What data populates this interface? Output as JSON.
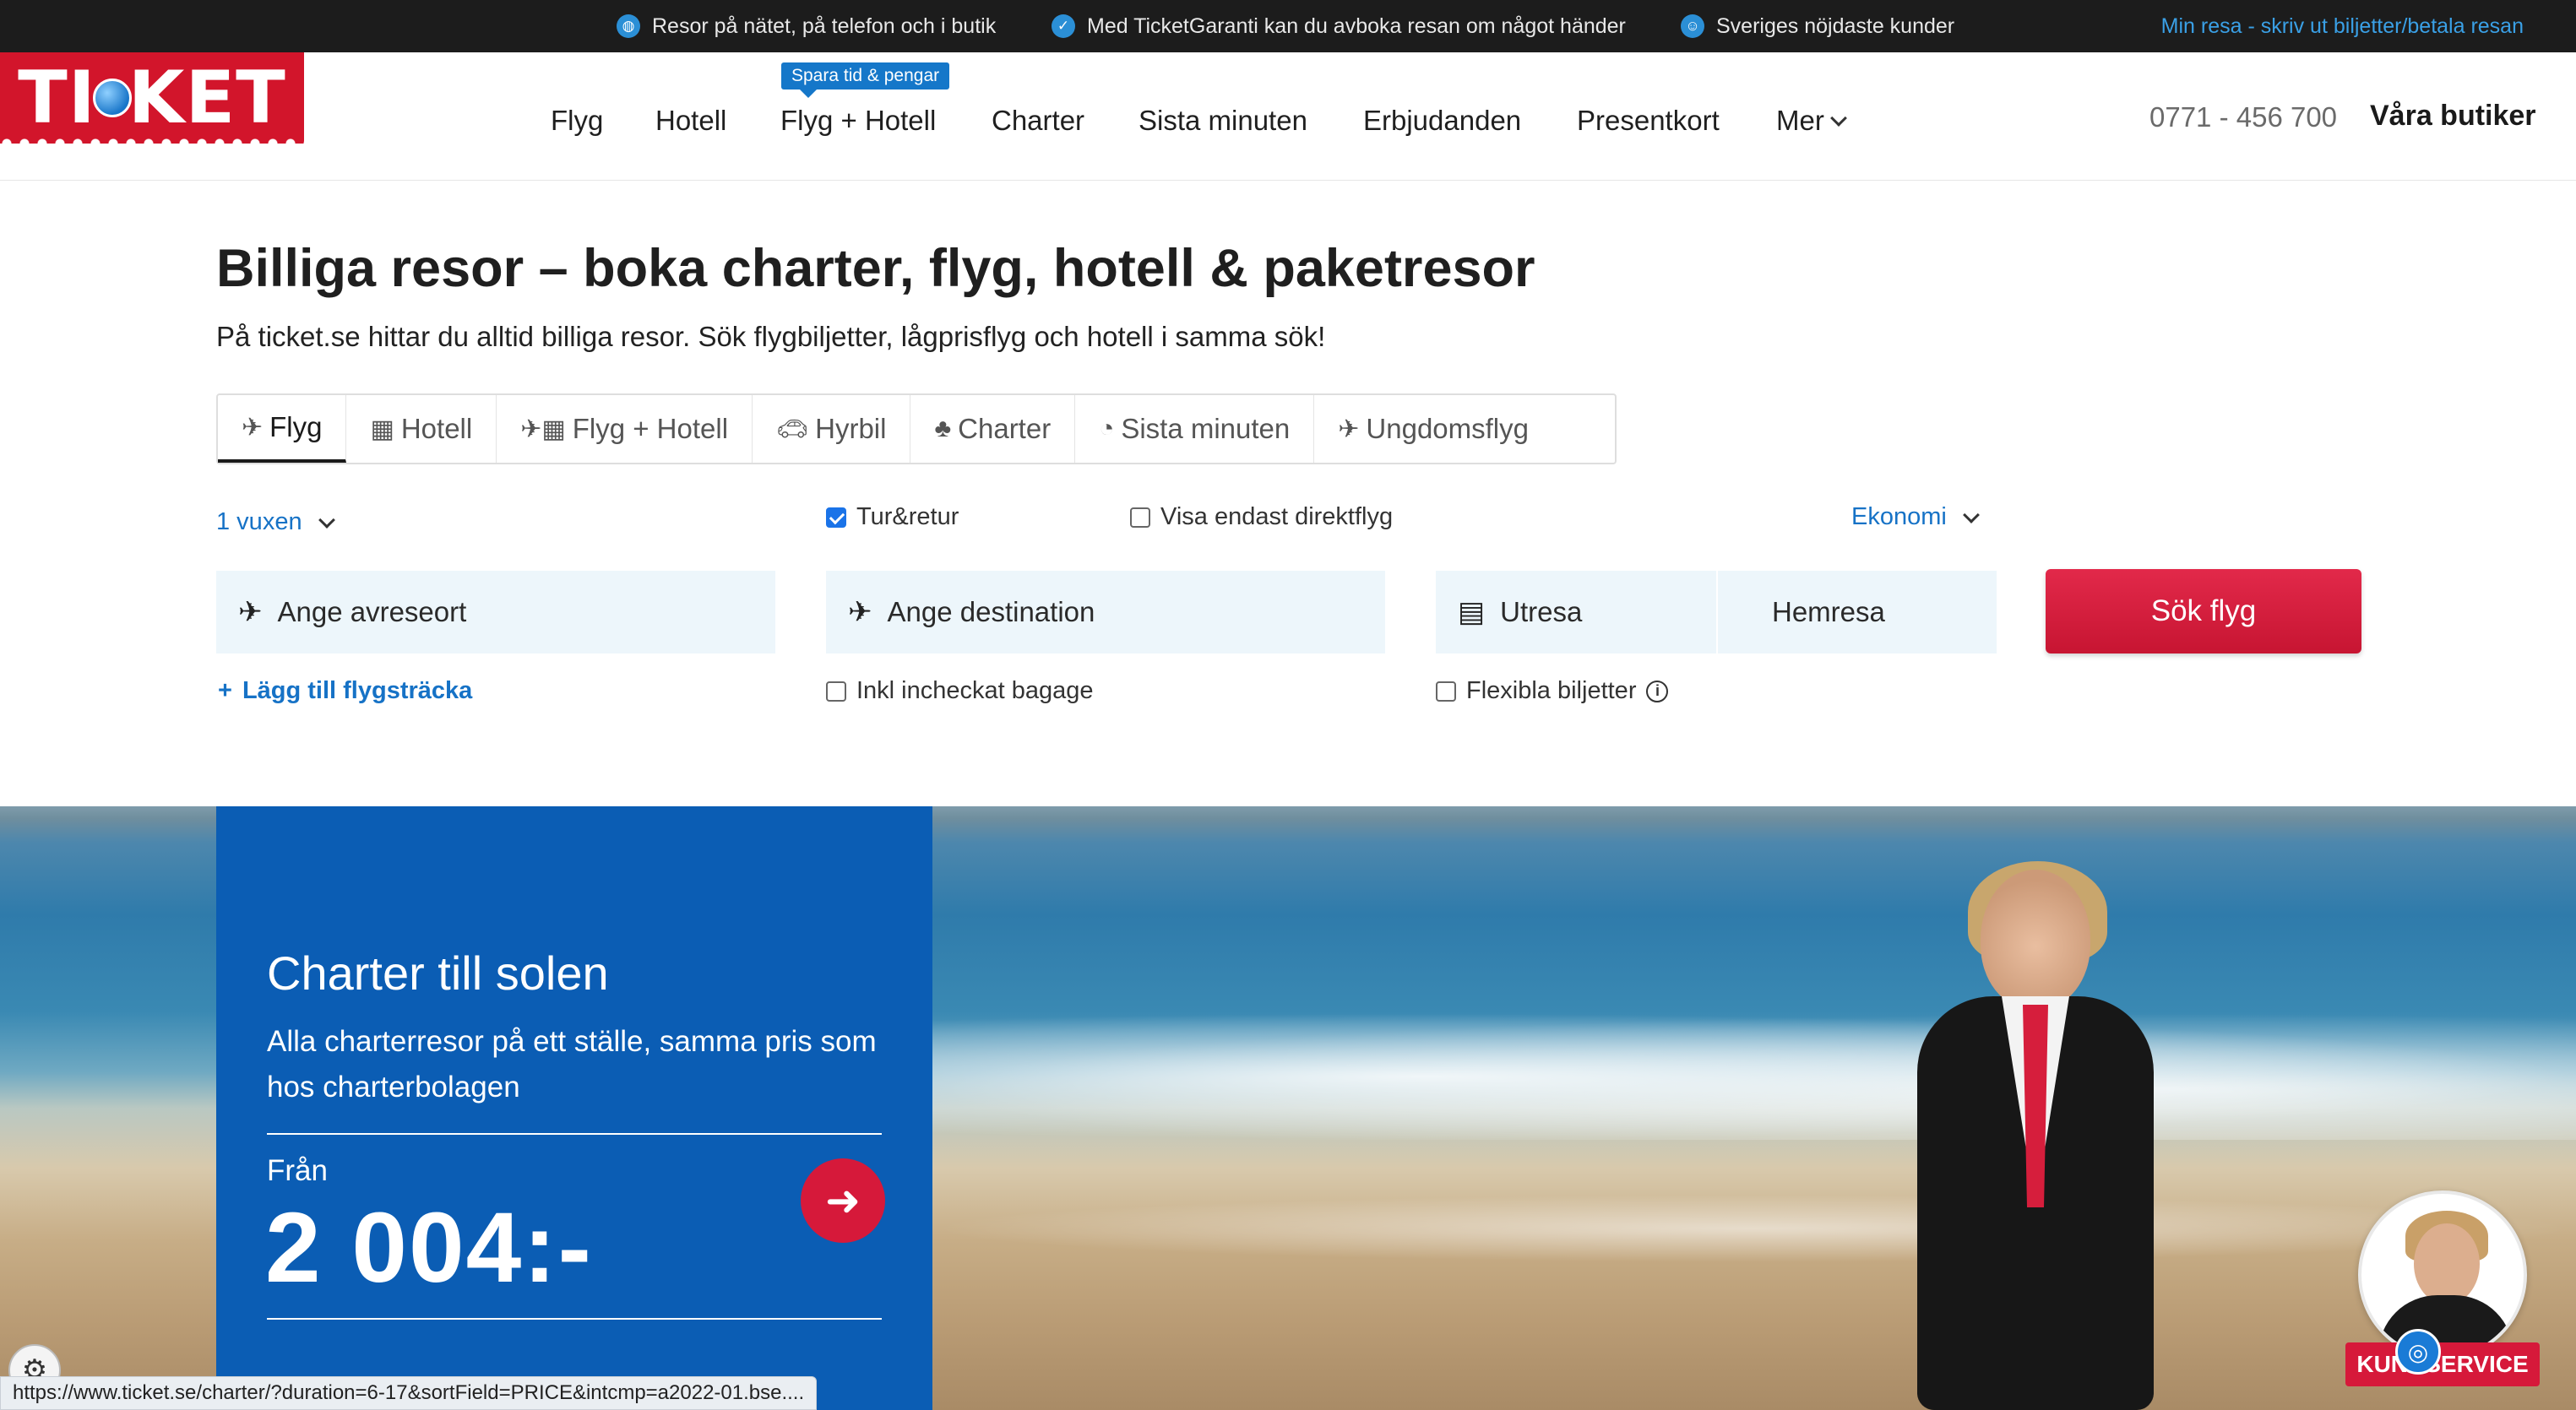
{
  "topbar": {
    "usps": [
      {
        "icon": "globe-icon",
        "text": "Resor på nätet, på telefon och i butik"
      },
      {
        "icon": "shield-check-icon",
        "text": "Med TicketGaranti kan du avboka resan om något händer"
      },
      {
        "icon": "smiley-icon",
        "text": "Sveriges nöjdaste kunder"
      }
    ],
    "my_trip_link": "Min resa - skriv ut biljetter/betala resan"
  },
  "header": {
    "logo_text_left": "TI",
    "logo_text_right": "KET",
    "nav": [
      "Flyg",
      "Hotell",
      "Flyg + Hotell",
      "Charter",
      "Sista minuten",
      "Erbjudanden",
      "Presentkort",
      "Mer"
    ],
    "badge": "Spara tid & pengar",
    "phone": "0771 - 456 700",
    "stores": "Våra butiker"
  },
  "hero": {
    "title": "Billiga resor – boka charter, flyg, hotell & paketresor",
    "lead": "På ticket.se hittar du alltid billiga resor. Sök flygbiljetter, lågprisflyg och hotell i samma sök!"
  },
  "tabs": [
    {
      "label": "Flyg",
      "icon": "plane-icon",
      "active": true
    },
    {
      "label": "Hotell",
      "icon": "building-icon",
      "active": false
    },
    {
      "label": "Flyg + Hotell",
      "icon": "plane-building-icon",
      "active": false
    },
    {
      "label": "Hyrbil",
      "icon": "car-icon",
      "active": false
    },
    {
      "label": "Charter",
      "icon": "palm-icon",
      "active": false
    },
    {
      "label": "Sista minuten",
      "icon": "clock-fire-icon",
      "active": false
    },
    {
      "label": "Ungdomsflyg",
      "icon": "plane-icon",
      "active": false
    }
  ],
  "search": {
    "passengers": "1 vuxen",
    "round_trip_label": "Tur&retur",
    "round_trip_checked": true,
    "direct_only_label": "Visa endast direktflyg",
    "direct_only_checked": false,
    "cabin_class": "Ekonomi",
    "origin_placeholder": "Ange avreseort",
    "destination_placeholder": "Ange destination",
    "depart_placeholder": "Utresa",
    "return_placeholder": "Hemresa",
    "search_button": "Sök flyg",
    "add_leg": "Lägg till flygsträcka",
    "baggage_label": "Inkl incheckat bagage",
    "flexible_label": "Flexibla biljetter"
  },
  "promo": {
    "title": "Charter till solen",
    "subtitle": "Alla charterresor på ett ställe, samma pris som hos charterbolagen",
    "from_label": "Från",
    "price": "2 004:-"
  },
  "status_url": "https://www.ticket.se/charter/?duration=6-17&sortField=PRICE&intcmp=a2022-01.bse....",
  "customer_service": {
    "label": "KUNDSERVICE"
  },
  "colors": {
    "brand_red": "#d2152b",
    "link_blue": "#1672c6",
    "promo_blue": "#0b5db4"
  }
}
